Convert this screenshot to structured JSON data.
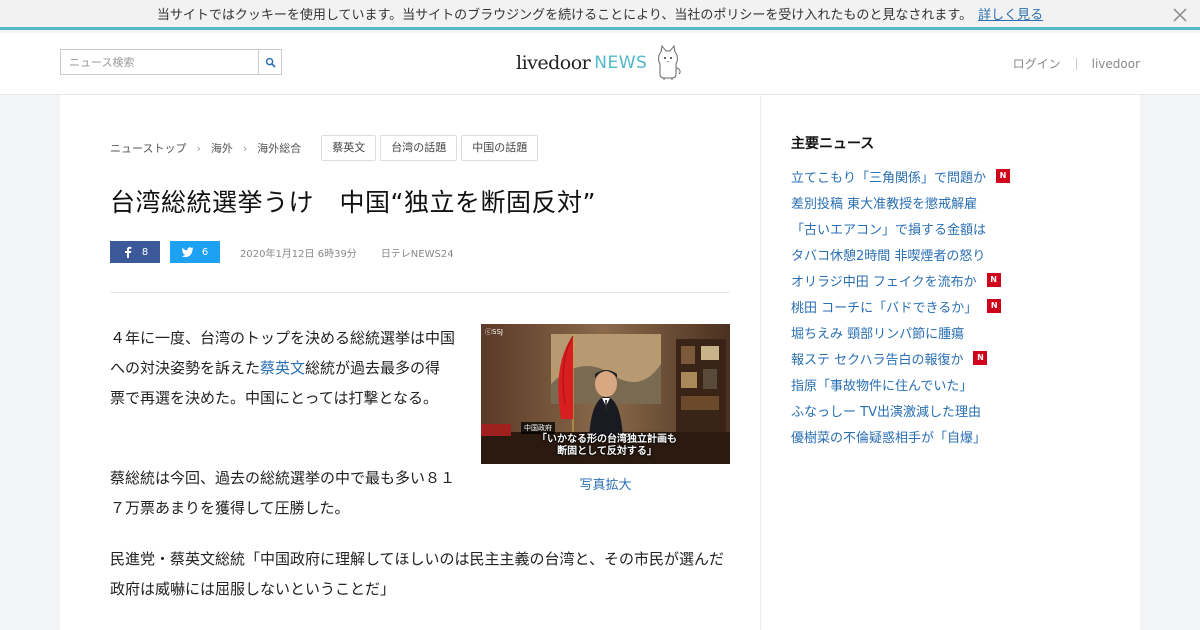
{
  "cookie": {
    "message": "当サイトではクッキーを使用しています。当サイトのブラウジングを続けることにより、当社のポリシーを受け入れたものと見なされます。",
    "more_link": "詳しく見る"
  },
  "header": {
    "search_placeholder": "ニュース検索",
    "logo_text": "livedoor",
    "logo_news": "NEWS",
    "links": [
      "ログイン",
      "livedoor"
    ]
  },
  "breadcrumb": [
    "ニューストップ",
    "海外",
    "海外総合"
  ],
  "tags": [
    "蔡英文",
    "台湾の話題",
    "中国の話題"
  ],
  "article": {
    "title": "台湾総統選挙うけ　中国“独立を断固反対”",
    "share": {
      "facebook_count": "8",
      "twitter_count": "6"
    },
    "date": "2020年1月12日 6時39分",
    "source": "日テレNEWS24",
    "p1_before": "４年に一度、台湾のトップを決める総統選挙は中国への対決姿勢を訴えた",
    "p1_link": "蔡英文",
    "p1_after": "総統が過去最多の得票で再選を決めた。中国にとっては打撃となる。",
    "p2": "蔡総統は今回、過去の総統選挙の中で最も多い８１７万票あまりを獲得して圧勝した。",
    "p3": "民進党・蔡英文総統「中国政府に理解してほしいのは民主主義の台湾と、その市民が選んだ政府は威嚇には屈服しないということだ」",
    "photo": {
      "badge": "ⓒSSJ",
      "caption_label": "中国政府",
      "caption_line1": "「いかなる形の台湾独立計画も",
      "caption_line2": "断固として反対する」",
      "enlarge": "写真拡大"
    }
  },
  "sidebar": {
    "title": "主要ニュース",
    "items": [
      {
        "text": "立てこもり「三角関係」で問題か",
        "new": true
      },
      {
        "text": "差別投稿 東大准教授を懲戒解雇",
        "new": false
      },
      {
        "text": "「古いエアコン」で損する金額は",
        "new": false
      },
      {
        "text": "タバコ休憩2時間 非喫煙者の怒り",
        "new": false
      },
      {
        "text": "オリラジ中田 フェイクを流布か",
        "new": true
      },
      {
        "text": "桃田 コーチに「バドできるか」",
        "new": true
      },
      {
        "text": "堀ちえみ 頸部リンパ節に腫瘍",
        "new": false
      },
      {
        "text": "報ステ セクハラ告白の報復か",
        "new": true
      },
      {
        "text": "指原「事故物件に住んでいた」",
        "new": false
      },
      {
        "text": "ふなっしー TV出演激減した理由",
        "new": false
      },
      {
        "text": "優樹菜の不倫疑惑相手が「自爆」",
        "new": false
      }
    ],
    "new_badge": "N"
  },
  "colors": {
    "accent": "#53b8c8",
    "link": "#2a6fb3",
    "facebook": "#3b5998",
    "twitter": "#1da1f2",
    "new_badge": "#d0021b"
  },
  "icons": [
    "close-icon",
    "search-icon",
    "dog-mascot-icon",
    "facebook-icon",
    "twitter-icon"
  ]
}
